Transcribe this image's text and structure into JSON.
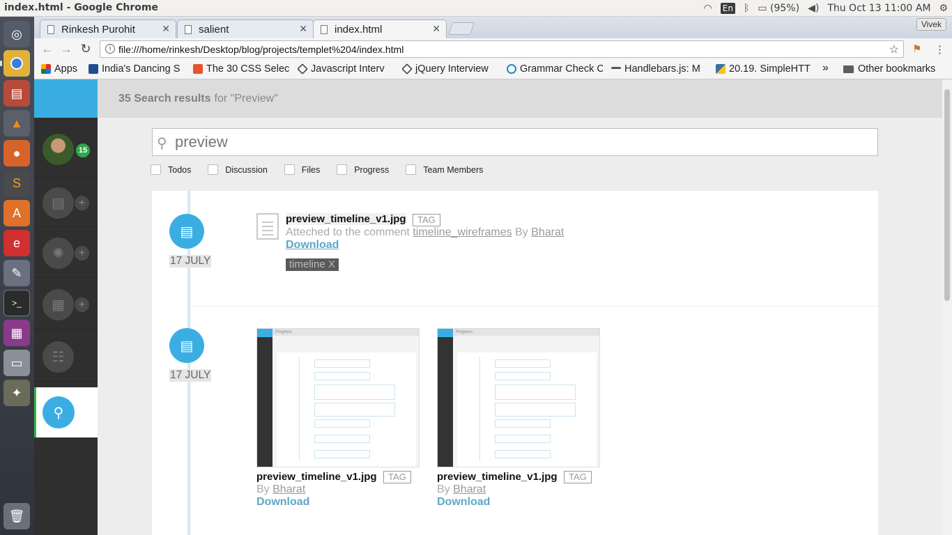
{
  "window": {
    "title": "index.html - Google Chrome"
  },
  "system_tray": {
    "keyboard": "En",
    "battery": "(95%)",
    "datetime": "Thu Oct 13 11:00 AM"
  },
  "tabs": [
    {
      "label": "Rinkesh Purohit"
    },
    {
      "label": "salient"
    },
    {
      "label": "index.html"
    }
  ],
  "profile": "Vivek",
  "address_bar": {
    "url": "file:///home/rinkesh/Desktop/blog/projects/templet%204/index.html"
  },
  "bookmarks": [
    {
      "label": "Apps",
      "color": "#d93025"
    },
    {
      "label": "India's Dancing S",
      "color": "#1f4e8c"
    },
    {
      "label": "The 30 CSS Select",
      "color": "#e8542c"
    },
    {
      "label": "Javascript Interv",
      "color": "#444444"
    },
    {
      "label": "jQuery Interview",
      "color": "#444444"
    },
    {
      "label": "Grammar Check C",
      "color": "#1a8fb8"
    },
    {
      "label": "Handlebars.js: M",
      "color": "#555555"
    },
    {
      "label": "20.19. SimpleHTT",
      "color": "#3a6ea5"
    }
  ],
  "bookmarks_more": "»",
  "other_bookmarks": "Other bookmarks",
  "sidebar": {
    "badge": "15",
    "accent": "#3aaee3",
    "active_marker": "#39b54a"
  },
  "header": {
    "count_label": "35 Search results",
    "query_label": "for \"Preview\""
  },
  "search": {
    "value": "preview"
  },
  "filters": [
    "Todos",
    "Discussion",
    "Files",
    "Progress",
    "Team Members"
  ],
  "results": [
    {
      "date": "17 JULY",
      "file_name": "preview_timeline_v1.jpg",
      "tag": "TAG",
      "attached_prefix": "Atteched to the comment",
      "comment_link": "timeline_wireframes",
      "by_prefix": "By",
      "author": "Bharat",
      "download": "Download",
      "chip": "timeline X"
    },
    {
      "date": "17 JULY",
      "items": [
        {
          "file_name": "preview_timeline_v1.jpg",
          "tag": "TAG",
          "by_prefix": "By",
          "author": "Bharat",
          "download": "Download",
          "thumb_header": "Progress"
        },
        {
          "file_name": "preview_timeline_v1.jpg",
          "tag": "TAG",
          "by_prefix": "By",
          "author": "Bharat",
          "download": "Download",
          "thumb_header": "Progress"
        }
      ]
    }
  ]
}
